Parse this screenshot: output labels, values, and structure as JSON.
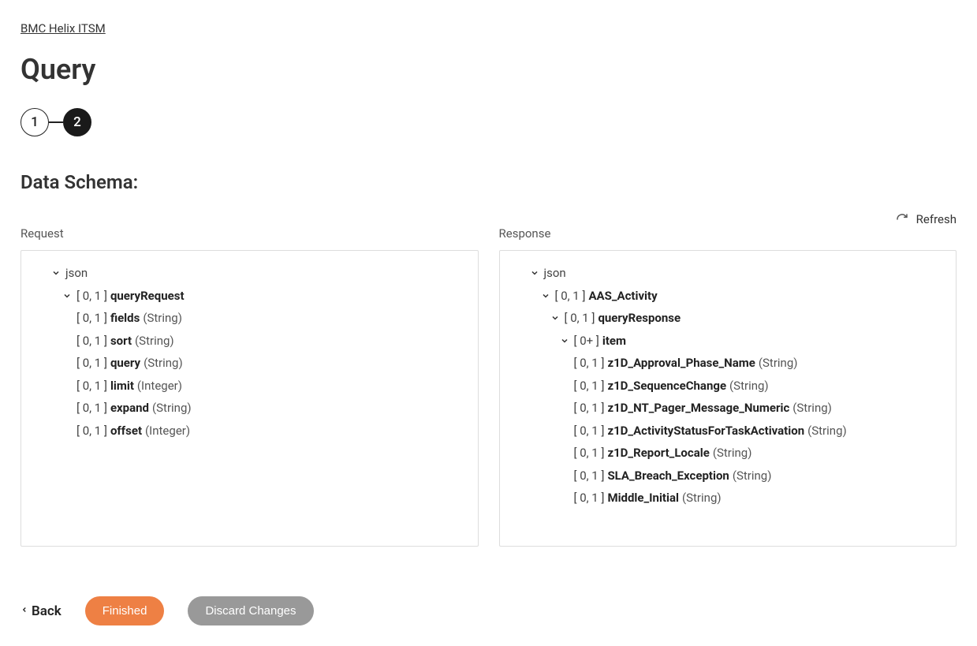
{
  "breadcrumb": {
    "label": "BMC Helix ITSM"
  },
  "title": "Query",
  "stepper": {
    "step1": "1",
    "step2": "2"
  },
  "section_title": "Data Schema:",
  "refresh_label": "Refresh",
  "request_label": "Request",
  "response_label": "Response",
  "cardinality": {
    "opt": "[ 0, 1 ]",
    "many": "[ 0+ ]"
  },
  "request_tree": {
    "root": "json",
    "queryRequest": "queryRequest",
    "fields": [
      {
        "name": "fields",
        "type": "(String)"
      },
      {
        "name": "sort",
        "type": "(String)"
      },
      {
        "name": "query",
        "type": "(String)"
      },
      {
        "name": "limit",
        "type": "(Integer)"
      },
      {
        "name": "expand",
        "type": "(String)"
      },
      {
        "name": "offset",
        "type": "(Integer)"
      }
    ]
  },
  "response_tree": {
    "root": "json",
    "aas": "AAS_Activity",
    "queryResponse": "queryResponse",
    "item": "item",
    "fields": [
      {
        "name": "z1D_Approval_Phase_Name",
        "type": "(String)"
      },
      {
        "name": "z1D_SequenceChange",
        "type": "(String)"
      },
      {
        "name": "z1D_NT_Pager_Message_Numeric",
        "type": "(String)"
      },
      {
        "name": "z1D_ActivityStatusForTaskActivation",
        "type": "(String)"
      },
      {
        "name": "z1D_Report_Locale",
        "type": "(String)"
      },
      {
        "name": "SLA_Breach_Exception",
        "type": "(String)"
      },
      {
        "name": "Middle_Initial",
        "type": "(String)"
      }
    ]
  },
  "footer": {
    "back": "Back",
    "finished": "Finished",
    "discard": "Discard Changes"
  }
}
